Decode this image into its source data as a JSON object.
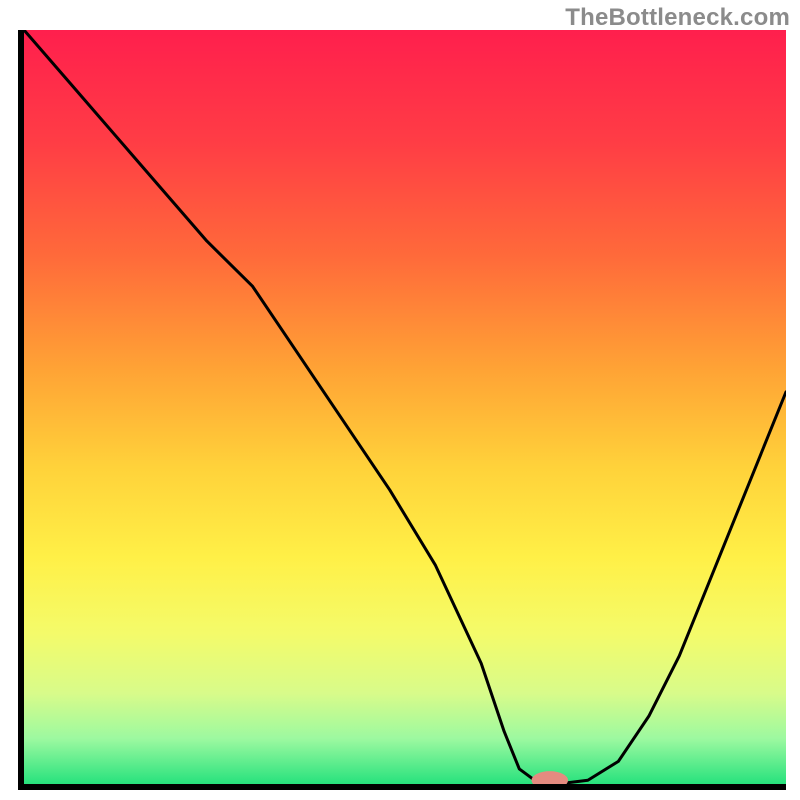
{
  "watermark": "TheBottleneck.com",
  "chart_data": {
    "type": "line",
    "title": "",
    "xlabel": "",
    "ylabel": "",
    "xlim": [
      0,
      100
    ],
    "ylim": [
      0,
      100
    ],
    "grid": false,
    "axes": {
      "left": true,
      "bottom": true,
      "color": "#000000",
      "width": 6
    },
    "background_gradient": [
      {
        "stop": 0.0,
        "color": "#ff1f4d"
      },
      {
        "stop": 0.15,
        "color": "#ff3d45"
      },
      {
        "stop": 0.3,
        "color": "#ff6a3a"
      },
      {
        "stop": 0.45,
        "color": "#ffa335"
      },
      {
        "stop": 0.58,
        "color": "#ffd23a"
      },
      {
        "stop": 0.7,
        "color": "#fff047"
      },
      {
        "stop": 0.8,
        "color": "#f4fb6a"
      },
      {
        "stop": 0.88,
        "color": "#d8fb8a"
      },
      {
        "stop": 0.94,
        "color": "#9cf9a0"
      },
      {
        "stop": 1.0,
        "color": "#27e27d"
      }
    ],
    "series": [
      {
        "name": "bottleneck-curve",
        "color": "#000000",
        "width": 3,
        "x": [
          0,
          6,
          12,
          18,
          24,
          30,
          36,
          42,
          48,
          54,
          60,
          63,
          65,
          67,
          70,
          74,
          78,
          82,
          86,
          90,
          94,
          98,
          100
        ],
        "y": [
          100,
          93,
          86,
          79,
          72,
          66,
          57,
          48,
          39,
          29,
          16,
          7,
          2,
          0.5,
          0,
          0.5,
          3,
          9,
          17,
          27,
          37,
          47,
          52
        ]
      }
    ],
    "marker": {
      "name": "optimal-point",
      "x": 69,
      "y": 0.5,
      "rx": 2.4,
      "ry": 1.2,
      "fill": "#e58b80"
    }
  }
}
